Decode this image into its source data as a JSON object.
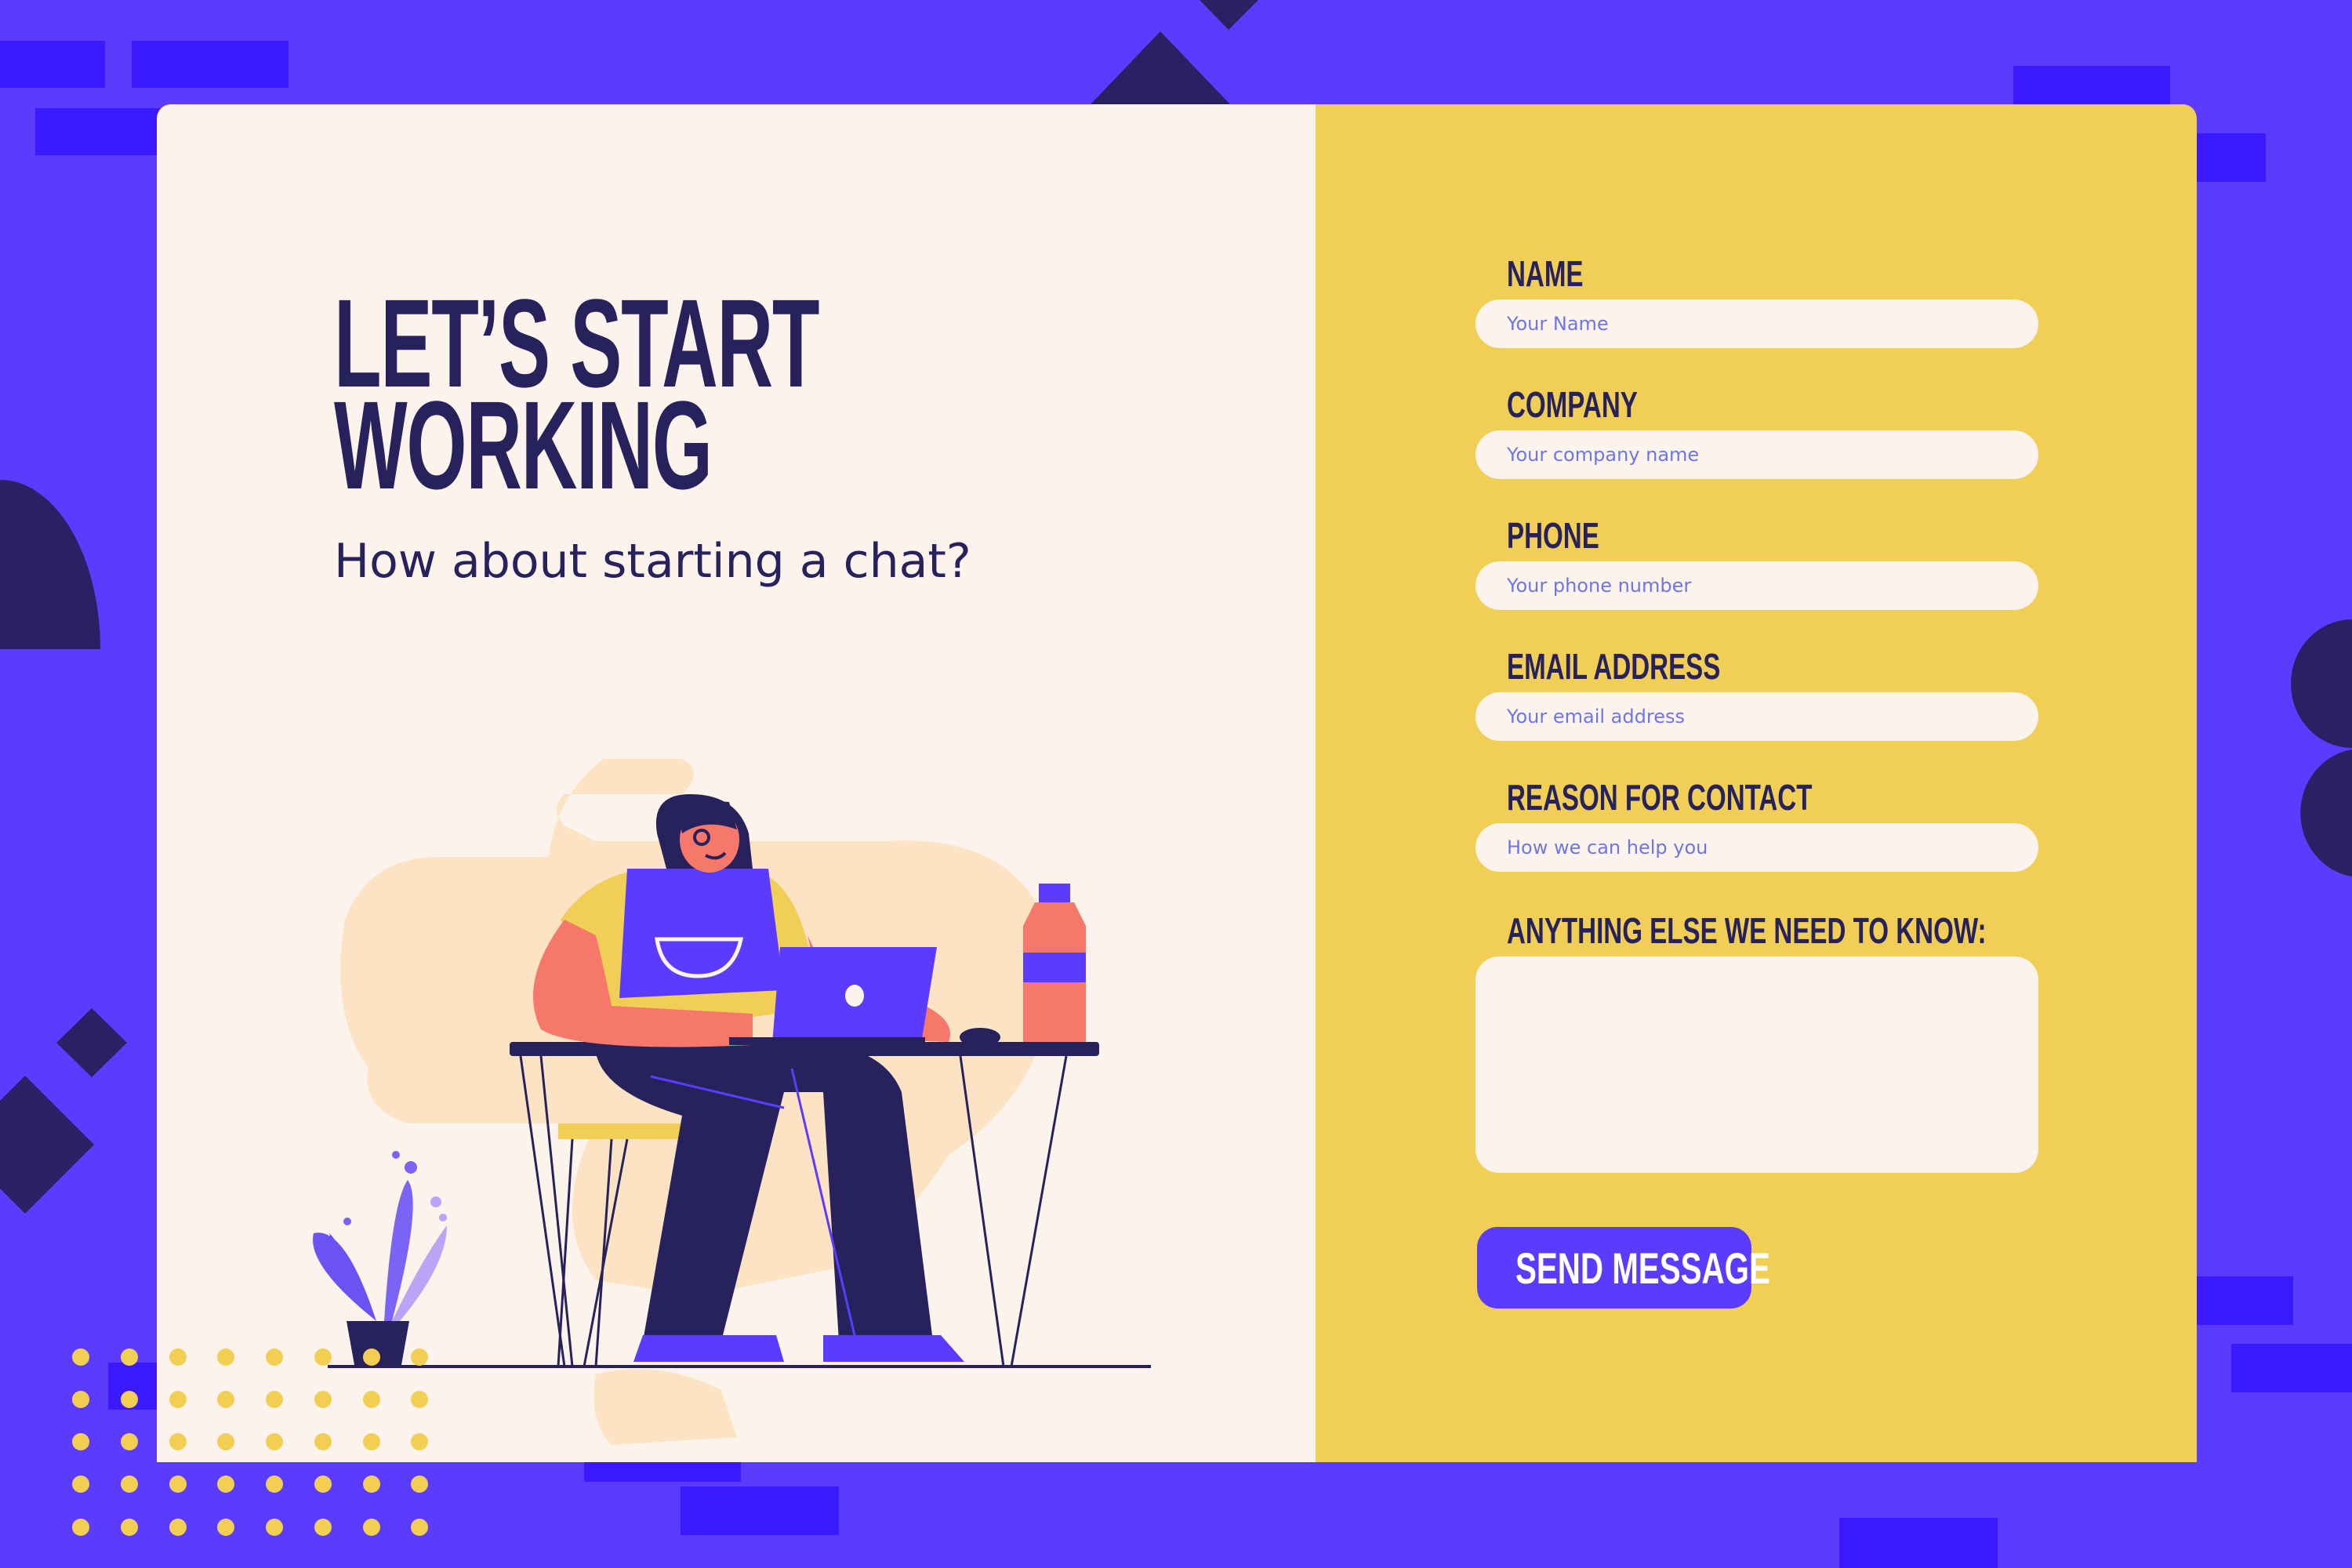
{
  "hero": {
    "title_line1": "LET’S START",
    "title_line2": "WORKING",
    "subtitle": "How about starting a chat?"
  },
  "form": {
    "fields": [
      {
        "label": "NAME",
        "placeholder": "Your Name"
      },
      {
        "label": "COMPANY",
        "placeholder": "Your company name"
      },
      {
        "label": "PHONE",
        "placeholder": "Your phone number"
      },
      {
        "label": "EMAIL ADDRESS",
        "placeholder": "Your email address"
      },
      {
        "label": "REASON FOR CONTACT",
        "placeholder": "How we can help you"
      }
    ],
    "message_label": "ANYTHING ELSE WE NEED TO KNOW:",
    "message_placeholder": "",
    "submit_label": "SEND MESSAGE"
  },
  "colors": {
    "background": "#5b3cff",
    "left_panel": "#fcf3ec",
    "right_panel": "#f1cf56",
    "text_dark": "#27215c",
    "accent": "#5b3cff",
    "dots": "#f2cf53"
  },
  "illustration": {
    "subject": "woman-working-at-laptop-illustration"
  }
}
